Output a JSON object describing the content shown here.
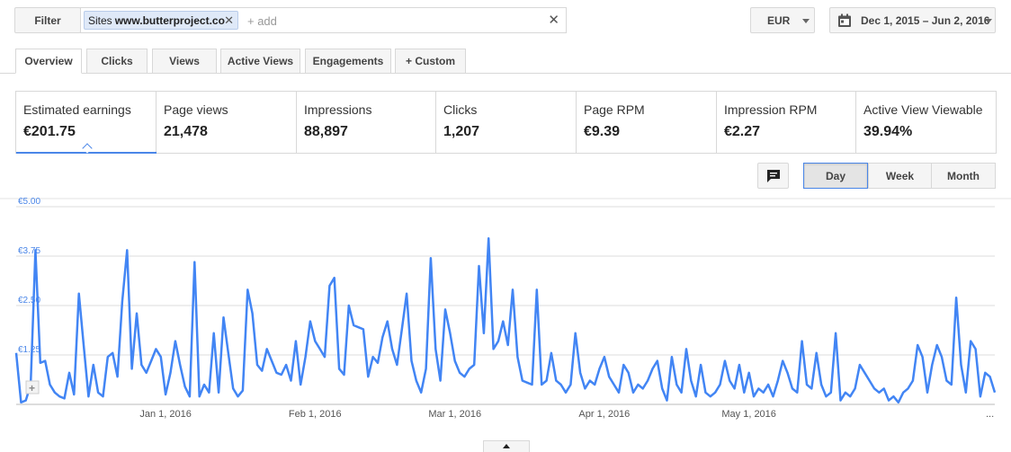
{
  "toolbar": {
    "filter_label": "Filter",
    "chip_prefix": "Sites",
    "chip_value": "www.butterproject.co",
    "add_placeholder": "+ add",
    "currency": "EUR",
    "date_range": "Dec 1, 2015 – Jun 2, 2016"
  },
  "tabs": [
    {
      "label": "Overview",
      "active": true
    },
    {
      "label": "Clicks",
      "active": false
    },
    {
      "label": "Views",
      "active": false
    },
    {
      "label": "Active Views",
      "active": false
    },
    {
      "label": "Engagements",
      "active": false
    },
    {
      "label": "+ Custom",
      "active": false
    }
  ],
  "metrics": [
    {
      "label": "Estimated earnings",
      "value": "€201.75",
      "selected": true
    },
    {
      "label": "Page views",
      "value": "21,478"
    },
    {
      "label": "Impressions",
      "value": "88,897"
    },
    {
      "label": "Clicks",
      "value": "1,207"
    },
    {
      "label": "Page RPM",
      "value": "€9.39"
    },
    {
      "label": "Impression RPM",
      "value": "€2.27"
    },
    {
      "label": "Active View Viewable",
      "value": "39.94%"
    }
  ],
  "granularity": [
    {
      "label": "Day",
      "active": true
    },
    {
      "label": "Week",
      "active": false
    },
    {
      "label": "Month",
      "active": false
    }
  ],
  "icons": [
    "close-icon",
    "calendar-icon",
    "comment-icon",
    "add-annotation-icon",
    "chevron-up-icon"
  ],
  "colors": {
    "accent": "#4a86e8",
    "line": "#4285f4"
  },
  "chart_data": {
    "type": "line",
    "series": [
      {
        "values": [
          1.3,
          0.05,
          0.1,
          0.5,
          3.9,
          1.05,
          1.1,
          0.5,
          0.3,
          0.2,
          0.15,
          0.8,
          0.25,
          2.8,
          1.5,
          0.2,
          1.0,
          0.3,
          0.2,
          1.2,
          1.3,
          0.7,
          2.6,
          3.9,
          0.9,
          2.3,
          1.0,
          0.8,
          1.1,
          1.4,
          1.2,
          0.25,
          0.8,
          1.6,
          1.0,
          0.45,
          0.2,
          3.6,
          0.2,
          0.5,
          0.3,
          1.8,
          0.3,
          2.2,
          1.3,
          0.4,
          0.2,
          0.35,
          2.9,
          2.3,
          1.0,
          0.85,
          1.4,
          1.1,
          0.8,
          0.75,
          1.0,
          0.6,
          1.6,
          0.5,
          1.2,
          2.1,
          1.6,
          1.4,
          1.2,
          3.0,
          3.2,
          0.9,
          0.75,
          2.5,
          2.0,
          1.95,
          1.9,
          0.7,
          1.2,
          1.05,
          1.7,
          2.1,
          1.4,
          1.0,
          1.9,
          2.8,
          1.1,
          0.6,
          0.3,
          0.9,
          3.7,
          1.4,
          0.6,
          2.4,
          1.8,
          1.1,
          0.8,
          0.7,
          0.9,
          1.0,
          3.5,
          1.8,
          4.2,
          1.4,
          1.6,
          2.1,
          1.5,
          2.9,
          1.2,
          0.6,
          0.55,
          0.5,
          2.9,
          0.5,
          0.6,
          1.3,
          0.6,
          0.5,
          0.3,
          0.5,
          1.8,
          0.8,
          0.4,
          0.6,
          0.5,
          0.9,
          1.2,
          0.7,
          0.5,
          0.3,
          1.0,
          0.8,
          0.3,
          0.5,
          0.4,
          0.6,
          0.9,
          1.1,
          0.4,
          0.1,
          1.2,
          0.5,
          0.3,
          1.4,
          0.6,
          0.2,
          1.0,
          0.3,
          0.2,
          0.3,
          0.5,
          1.1,
          0.6,
          0.4,
          1.0,
          0.3,
          0.8,
          0.2,
          0.4,
          0.3,
          0.5,
          0.2,
          0.6,
          1.1,
          0.8,
          0.4,
          0.3,
          1.6,
          0.5,
          0.4,
          1.3,
          0.5,
          0.2,
          0.3,
          1.8,
          0.1,
          0.3,
          0.2,
          0.4,
          1.0,
          0.8,
          0.6,
          0.4,
          0.3,
          0.4,
          0.1,
          0.2,
          0.05,
          0.3,
          0.4,
          0.6,
          1.5,
          1.2,
          0.3,
          1.0,
          1.5,
          1.2,
          0.6,
          0.5,
          2.7,
          1.0,
          0.3,
          1.6,
          1.4,
          0.2,
          0.8,
          0.7,
          0.3
        ]
      }
    ],
    "x_ticks": [
      "Jan 1, 2016",
      "Feb 1, 2016",
      "Mar 1, 2016",
      "Apr 1, 2016",
      "May 1, 2016"
    ],
    "y_ticks": [
      "€1.25",
      "€2.50",
      "€3.75",
      "€5.00"
    ],
    "ylim": [
      0,
      5
    ],
    "grid": true,
    "overflow_marker": "..."
  }
}
